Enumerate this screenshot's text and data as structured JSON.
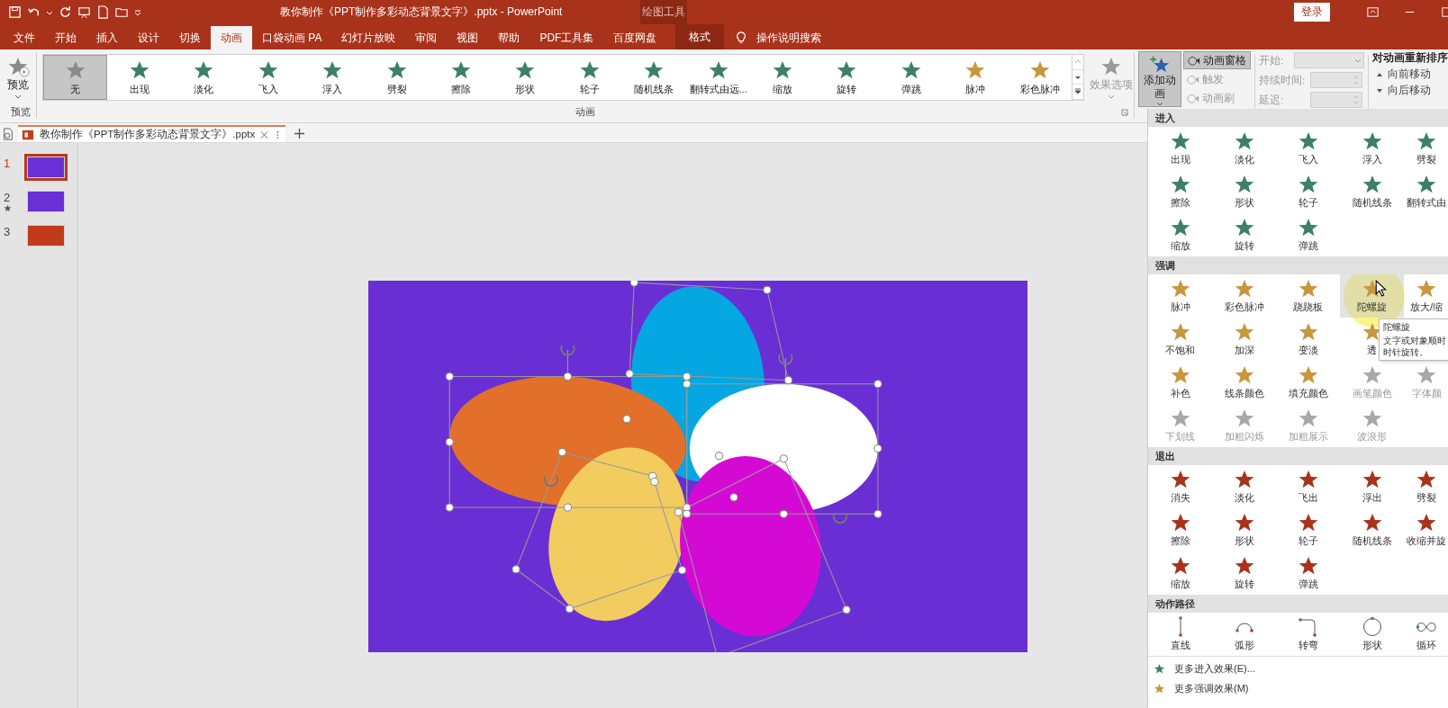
{
  "title_bar": {
    "title": "教你制作《PPT制作多彩动态背景文字》.pptx  -  PowerPoint",
    "context_label": "绘图工具",
    "login": "登录"
  },
  "menu_tabs": [
    {
      "label": "文件",
      "selected": false,
      "kind": "normal"
    },
    {
      "label": "开始",
      "selected": false,
      "kind": "normal"
    },
    {
      "label": "插入",
      "selected": false,
      "kind": "normal"
    },
    {
      "label": "设计",
      "selected": false,
      "kind": "normal"
    },
    {
      "label": "切换",
      "selected": false,
      "kind": "normal"
    },
    {
      "label": "动画",
      "selected": true,
      "kind": "normal"
    },
    {
      "label": "口袋动画 PA",
      "selected": false,
      "kind": "normal"
    },
    {
      "label": "幻灯片放映",
      "selected": false,
      "kind": "normal"
    },
    {
      "label": "审阅",
      "selected": false,
      "kind": "normal"
    },
    {
      "label": "视图",
      "selected": false,
      "kind": "normal"
    },
    {
      "label": "帮助",
      "selected": false,
      "kind": "normal"
    },
    {
      "label": "PDF工具集",
      "selected": false,
      "kind": "normal"
    },
    {
      "label": "百度网盘",
      "selected": false,
      "kind": "normal"
    },
    {
      "label": "格式",
      "selected": false,
      "kind": "contextual"
    }
  ],
  "tell_me": {
    "placeholder": "操作说明搜索"
  },
  "ribbon": {
    "preview": {
      "button": "预览",
      "group_label": "预览"
    },
    "gallery": {
      "group_label": "动画",
      "items": [
        {
          "label": "无",
          "selected": true,
          "kind": "none"
        },
        {
          "label": "出现",
          "selected": false,
          "kind": "entrance"
        },
        {
          "label": "淡化",
          "selected": false,
          "kind": "entrance"
        },
        {
          "label": "飞入",
          "selected": false,
          "kind": "entrance"
        },
        {
          "label": "浮入",
          "selected": false,
          "kind": "entrance"
        },
        {
          "label": "劈裂",
          "selected": false,
          "kind": "entrance"
        },
        {
          "label": "擦除",
          "selected": false,
          "kind": "entrance"
        },
        {
          "label": "形状",
          "selected": false,
          "kind": "entrance"
        },
        {
          "label": "轮子",
          "selected": false,
          "kind": "entrance"
        },
        {
          "label": "随机线条",
          "selected": false,
          "kind": "entrance"
        },
        {
          "label": "翻转式由远...",
          "selected": false,
          "kind": "entrance"
        },
        {
          "label": "缩放",
          "selected": false,
          "kind": "entrance"
        },
        {
          "label": "旋转",
          "selected": false,
          "kind": "entrance"
        },
        {
          "label": "弹跳",
          "selected": false,
          "kind": "entrance"
        },
        {
          "label": "脉冲",
          "selected": false,
          "kind": "emphasis"
        },
        {
          "label": "彩色脉冲",
          "selected": false,
          "kind": "emphasis"
        }
      ]
    },
    "effect_options": {
      "label": "效果选项",
      "disabled": true
    },
    "add_animation": {
      "label": "添加动画",
      "on": true
    },
    "advanced": [
      {
        "label": "动画窗格",
        "on": true,
        "disabled": false
      },
      {
        "label": "触发",
        "on": false,
        "disabled": true
      },
      {
        "label": "动画刷",
        "on": false,
        "disabled": true
      }
    ],
    "timing": [
      {
        "label": "开始:",
        "kind": "dropdown",
        "disabled": true
      },
      {
        "label": "持续时间:",
        "kind": "spinner",
        "disabled": true
      },
      {
        "label": "延迟:",
        "kind": "spinner",
        "disabled": true
      }
    ],
    "reorder": {
      "title": "对动画重新排序",
      "items": [
        "向前移动",
        "向后移动"
      ]
    }
  },
  "doc_tab": {
    "title": "教你制作《PPT制作多彩动态背景文字》.pptx"
  },
  "thumbnails": [
    {
      "number": "1",
      "selected": true,
      "animated": false,
      "color": "#6b2fd6"
    },
    {
      "number": "2",
      "selected": false,
      "animated": true,
      "color": "#6b2fd6"
    },
    {
      "number": "3",
      "selected": false,
      "animated": false,
      "color": "#c23a1c"
    }
  ],
  "animation_menu": {
    "sections": [
      {
        "title": "进入",
        "kind": "entrance",
        "rows": [
          [
            {
              "label": "出现",
              "selected": false,
              "disabled": false
            },
            {
              "label": "淡化",
              "selected": false,
              "disabled": false
            },
            {
              "label": "飞入",
              "selected": false,
              "disabled": false
            },
            {
              "label": "浮入",
              "selected": false,
              "disabled": false
            },
            {
              "label": "劈裂",
              "selected": false,
              "disabled": false
            }
          ],
          [
            {
              "label": "擦除",
              "selected": false,
              "disabled": false
            },
            {
              "label": "形状",
              "selected": false,
              "disabled": false
            },
            {
              "label": "轮子",
              "selected": false,
              "disabled": false
            },
            {
              "label": "随机线条",
              "selected": false,
              "disabled": false
            },
            {
              "label": "翻转式由",
              "selected": false,
              "disabled": false
            }
          ],
          [
            {
              "label": "缩放",
              "selected": false,
              "disabled": false
            },
            {
              "label": "旋转",
              "selected": false,
              "disabled": false
            },
            {
              "label": "弹跳",
              "selected": false,
              "disabled": false
            }
          ]
        ]
      },
      {
        "title": "强调",
        "kind": "emphasis",
        "rows": [
          [
            {
              "label": "脉冲",
              "selected": false,
              "disabled": false
            },
            {
              "label": "彩色脉冲",
              "selected": false,
              "disabled": false
            },
            {
              "label": "跷跷板",
              "selected": false,
              "disabled": false
            },
            {
              "label": "陀螺旋",
              "selected": true,
              "disabled": false
            },
            {
              "label": "放大/缩",
              "selected": false,
              "disabled": false
            }
          ],
          [
            {
              "label": "不饱和",
              "selected": false,
              "disabled": false
            },
            {
              "label": "加深",
              "selected": false,
              "disabled": false
            },
            {
              "label": "变淡",
              "selected": false,
              "disabled": false
            },
            {
              "label": "透",
              "selected": false,
              "disabled": false
            }
          ],
          [
            {
              "label": "补色",
              "selected": false,
              "disabled": false
            },
            {
              "label": "线条颜色",
              "selected": false,
              "disabled": false
            },
            {
              "label": "填充颜色",
              "selected": false,
              "disabled": false
            },
            {
              "label": "画笔颜色",
              "selected": false,
              "disabled": true
            },
            {
              "label": "字体颜",
              "selected": false,
              "disabled": true
            }
          ],
          [
            {
              "label": "下划线",
              "selected": false,
              "disabled": true
            },
            {
              "label": "加粗闪烁",
              "selected": false,
              "disabled": true
            },
            {
              "label": "加粗展示",
              "selected": false,
              "disabled": true
            },
            {
              "label": "波浪形",
              "selected": false,
              "disabled": true
            }
          ]
        ]
      },
      {
        "title": "退出",
        "kind": "exit",
        "rows": [
          [
            {
              "label": "消失",
              "selected": false,
              "disabled": false
            },
            {
              "label": "淡化",
              "selected": false,
              "disabled": false
            },
            {
              "label": "飞出",
              "selected": false,
              "disabled": false
            },
            {
              "label": "浮出",
              "selected": false,
              "disabled": false
            },
            {
              "label": "劈裂",
              "selected": false,
              "disabled": false
            }
          ],
          [
            {
              "label": "擦除",
              "selected": false,
              "disabled": false
            },
            {
              "label": "形状",
              "selected": false,
              "disabled": false
            },
            {
              "label": "轮子",
              "selected": false,
              "disabled": false
            },
            {
              "label": "随机线条",
              "selected": false,
              "disabled": false
            },
            {
              "label": "收缩并旋",
              "selected": false,
              "disabled": false
            }
          ],
          [
            {
              "label": "缩放",
              "selected": false,
              "disabled": false
            },
            {
              "label": "旋转",
              "selected": false,
              "disabled": false
            },
            {
              "label": "弹跳",
              "selected": false,
              "disabled": false
            }
          ]
        ]
      },
      {
        "title": "动作路径",
        "kind": "path",
        "rows": [
          [
            {
              "label": "直线",
              "selected": false,
              "disabled": false,
              "kind": "line"
            },
            {
              "label": "弧形",
              "selected": false,
              "disabled": false,
              "kind": "arc"
            },
            {
              "label": "转弯",
              "selected": false,
              "disabled": false,
              "kind": "turn"
            },
            {
              "label": "形状",
              "selected": false,
              "disabled": false,
              "kind": "shape"
            },
            {
              "label": "循环",
              "selected": false,
              "disabled": false,
              "kind": "loop"
            }
          ]
        ]
      }
    ],
    "more": [
      {
        "label": "更多进入效果(E)...",
        "kind": "entrance"
      },
      {
        "label": "更多强调效果(M)",
        "kind": "emphasis"
      }
    ],
    "tooltip": {
      "title": "陀螺旋",
      "lines": [
        "文字或对象顺时",
        "时针旋转。"
      ]
    }
  }
}
